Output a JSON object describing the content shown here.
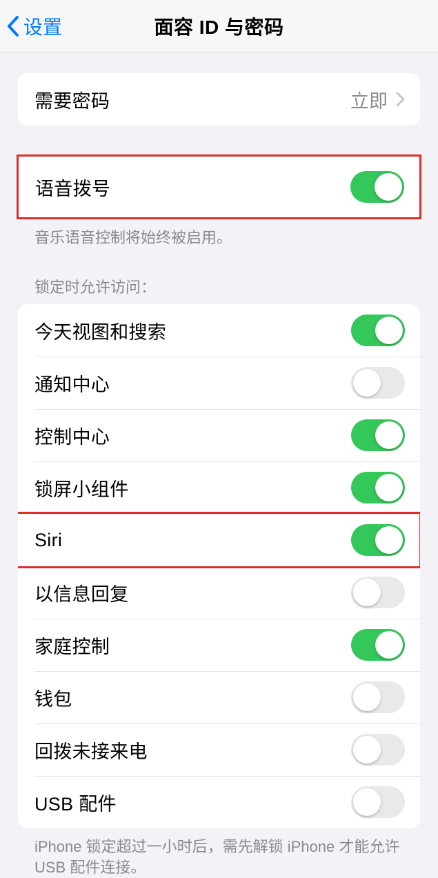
{
  "header": {
    "back_label": "设置",
    "title": "面容 ID 与密码"
  },
  "rows": {
    "require_passcode": {
      "label": "需要密码",
      "value": "立即"
    },
    "voice_dial": {
      "label": "语音拨号",
      "on": true
    },
    "voice_dial_footer": "音乐语音控制将始终被启用。",
    "lock_header": "锁定时允许访问：",
    "today_view": {
      "label": "今天视图和搜索",
      "on": true
    },
    "notification_center": {
      "label": "通知中心",
      "on": false
    },
    "control_center": {
      "label": "控制中心",
      "on": true
    },
    "lock_widgets": {
      "label": "锁屏小组件",
      "on": true
    },
    "siri": {
      "label": "Siri",
      "on": true
    },
    "reply_message": {
      "label": "以信息回复",
      "on": false
    },
    "home_control": {
      "label": "家庭控制",
      "on": true
    },
    "wallet": {
      "label": "钱包",
      "on": false
    },
    "return_calls": {
      "label": "回拨未接来电",
      "on": false
    },
    "usb": {
      "label": "USB 配件",
      "on": false
    },
    "usb_footer": "iPhone 锁定超过一小时后，需先解锁 iPhone 才能允许 USB 配件连接。"
  }
}
